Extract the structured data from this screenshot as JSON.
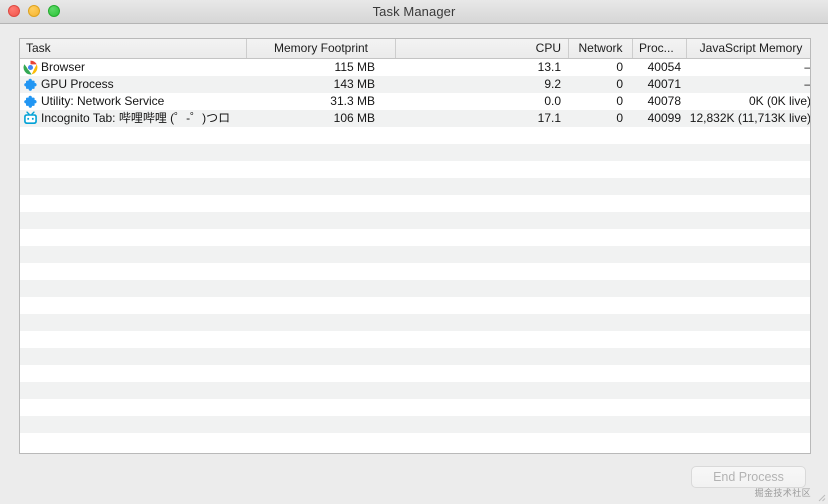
{
  "window": {
    "title": "Task Manager",
    "traffic_lights": [
      {
        "name": "close",
        "color": "#f1554c"
      },
      {
        "name": "minimize",
        "color": "#f6b430"
      },
      {
        "name": "maximize",
        "color": "#29c436"
      }
    ]
  },
  "table": {
    "columns": [
      {
        "key": "task",
        "label": "Task",
        "align": "left"
      },
      {
        "key": "memory",
        "label": "Memory Footprint",
        "align": "right"
      },
      {
        "key": "cpu",
        "label": "CPU",
        "align": "right"
      },
      {
        "key": "network",
        "label": "Network",
        "align": "right"
      },
      {
        "key": "process_id",
        "label": "Proc...",
        "align": "right"
      },
      {
        "key": "js_memory",
        "label": "JavaScript Memory",
        "align": "right"
      }
    ],
    "rows": [
      {
        "icon": "chrome-icon",
        "task": "Browser",
        "memory": "115 MB",
        "cpu": "13.1",
        "network": "0",
        "process_id": "40054",
        "js_memory": "–"
      },
      {
        "icon": "puzzle-icon",
        "task": "GPU Process",
        "memory": "143 MB",
        "cpu": "9.2",
        "network": "0",
        "process_id": "40071",
        "js_memory": "–"
      },
      {
        "icon": "puzzle-icon",
        "task": "Utility: Network Service",
        "memory": "31.3 MB",
        "cpu": "0.0",
        "network": "0",
        "process_id": "40078",
        "js_memory": "0K (0K live)"
      },
      {
        "icon": "bilibili-icon",
        "task": "Incognito Tab: 哔哩哔哩 (゜-゜)つロ",
        "memory": "106 MB",
        "cpu": "17.1",
        "network": "0",
        "process_id": "40099",
        "js_memory": "12,832K (11,713K live)"
      }
    ],
    "empty_row_count": 19
  },
  "footer": {
    "end_process_label": "End Process",
    "end_process_enabled": false,
    "watermark": "掘金技术社区"
  },
  "colors": {
    "window_background": "#ececec",
    "table_background": "#ffffff",
    "row_stripe": "#f1f2f2",
    "header_background": "#efefef",
    "border": "#b9b9b9",
    "text": "#161616",
    "disabled_text": "#b3b3b3"
  }
}
